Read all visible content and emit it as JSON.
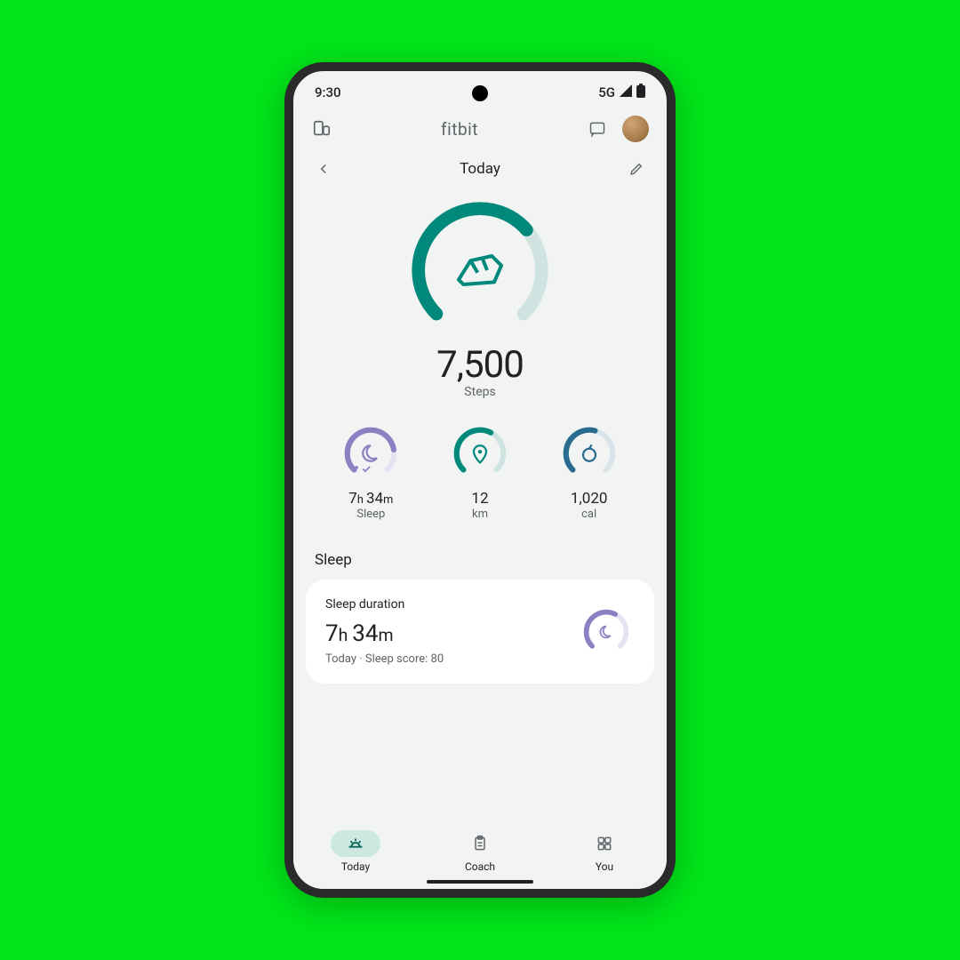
{
  "status": {
    "time": "9:30",
    "network": "5G"
  },
  "header": {
    "brand": "fitbit"
  },
  "dateRow": {
    "label": "Today"
  },
  "mainMetric": {
    "value": "7,500",
    "label": "Steps",
    "progress": 0.68
  },
  "metrics": {
    "sleep": {
      "hours": "7",
      "minutes": "34",
      "label": "Sleep",
      "progress": 0.8,
      "color": "#8d80c2"
    },
    "distance": {
      "value": "12",
      "label": "km",
      "progress": 0.6,
      "color": "#00897b"
    },
    "calories": {
      "value": "1,020",
      "label": "cal",
      "progress": 0.55,
      "color": "#2a6c8f"
    }
  },
  "section": {
    "title": "Sleep"
  },
  "card": {
    "title": "Sleep duration",
    "hours": "7",
    "minutes": "34",
    "subtext": "Today · Sleep score: 80",
    "progress": 0.6
  },
  "nav": {
    "items": [
      {
        "label": "Today",
        "active": true
      },
      {
        "label": "Coach",
        "active": false
      },
      {
        "label": "You",
        "active": false
      }
    ]
  }
}
